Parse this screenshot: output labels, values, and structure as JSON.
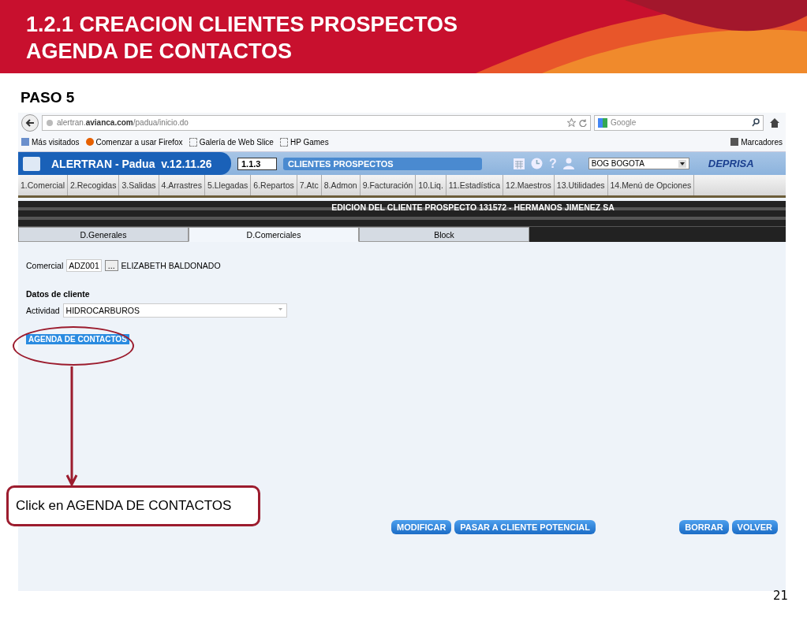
{
  "slide": {
    "title_lines": [
      "1.2.1 CREACION CLIENTES PROSPECTOS",
      "AGENDA DE CONTACTOS"
    ],
    "step": "PASO 5",
    "page_number": "21"
  },
  "browser": {
    "url_host": "alertran.",
    "url_domain": "avianca.com",
    "url_path": "/padua/inicio.do",
    "search_placeholder": "Google",
    "bookmarks": [
      {
        "kind": "folder",
        "label": "Más visitados"
      },
      {
        "kind": "firefox",
        "label": "Comenzar a usar Firefox"
      },
      {
        "kind": "slice",
        "label": "Galería de Web Slice"
      },
      {
        "kind": "slice",
        "label": "HP Games"
      }
    ],
    "bookmarks_menu": "Marcadores"
  },
  "app": {
    "title": "ALERTRAN - Padua  v.12.11.26",
    "screen_code": "1.1.3",
    "screen_name": "CLIENTES PROSPECTOS",
    "help_icon": "?",
    "office": "BOG BOGOTA",
    "logo": "DEPRISA",
    "menu": [
      "1.Comercial",
      "2.Recogidas",
      "3.Salidas",
      "4.Arrastres",
      "5.Llegadas",
      "6.Repartos",
      "7.Atc",
      "8.Admon",
      "9.Facturación",
      "10.Liq.",
      "11.Estadística",
      "12.Maestros",
      "13.Utilidades",
      "14.Menú de Opciones"
    ],
    "form_title": "EDICION DEL CLIENTE PROSPECTO 131572 - HERMANOS JIMENEZ SA",
    "tabs": [
      {
        "label": "D.Generales",
        "selected": false
      },
      {
        "label": "D.Comerciales",
        "selected": true
      },
      {
        "label": "Block",
        "selected": false
      }
    ],
    "comercial_label": "Comercial",
    "comercial_code": "ADZ001",
    "lookup_button": "...",
    "comercial_name": "ELIZABETH BALDONADO",
    "section_title": "Datos de cliente",
    "actividad_label": "Actividad",
    "actividad_value": "HIDROCARBUROS",
    "contacts_button": "AGENDA DE CONTACTOS",
    "left_buttons": [
      "MODIFICAR",
      "PASAR A CLIENTE POTENCIAL"
    ],
    "right_buttons": [
      "BORRAR",
      "VOLVER"
    ]
  },
  "annotation": {
    "callout": "Click en AGENDA DE CONTACTOS"
  }
}
